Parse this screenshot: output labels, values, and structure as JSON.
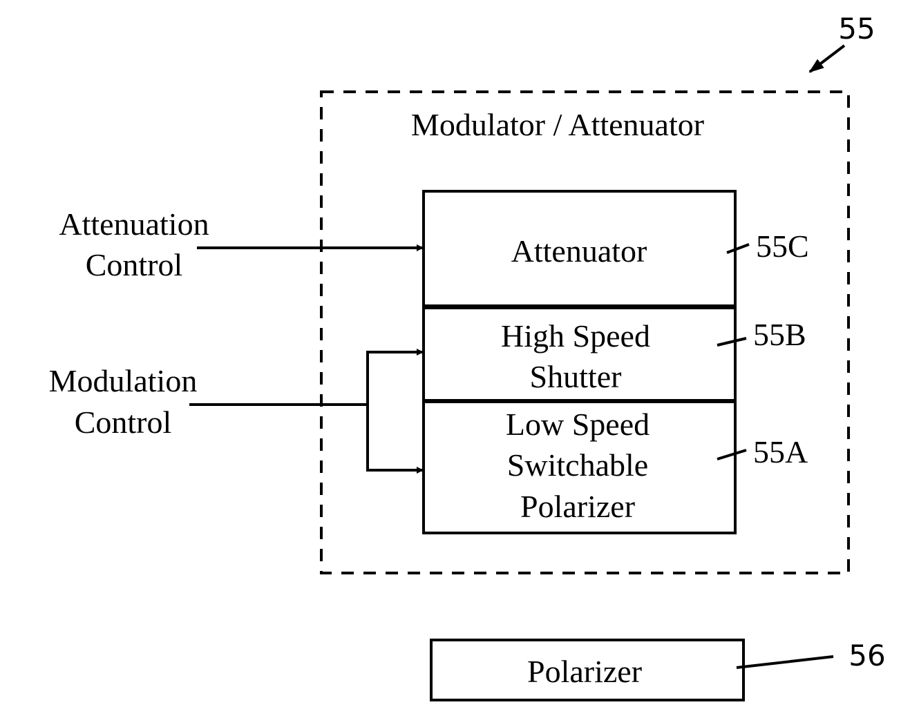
{
  "diagram": {
    "container": {
      "ref": "55",
      "title": "Modulator / Attenuator"
    },
    "blocks": [
      {
        "id": "attenuator",
        "lines": [
          "Attenuator"
        ],
        "ref": "55C"
      },
      {
        "id": "high-speed-shutter",
        "lines": [
          "High Speed",
          "Shutter"
        ],
        "ref": "55B"
      },
      {
        "id": "low-speed-switchable-polarizer",
        "lines": [
          "Low Speed",
          "Switchable",
          "Polarizer"
        ],
        "ref": "55A"
      }
    ],
    "inputs": [
      {
        "id": "attenuation-control",
        "lines": [
          "Attenuation",
          "Control"
        ],
        "targets": [
          "attenuator"
        ]
      },
      {
        "id": "modulation-control",
        "lines": [
          "Modulation",
          "Control"
        ],
        "targets": [
          "high-speed-shutter",
          "low-speed-switchable-polarizer"
        ]
      }
    ],
    "external": {
      "id": "polarizer",
      "label": "Polarizer",
      "ref": "56"
    }
  }
}
